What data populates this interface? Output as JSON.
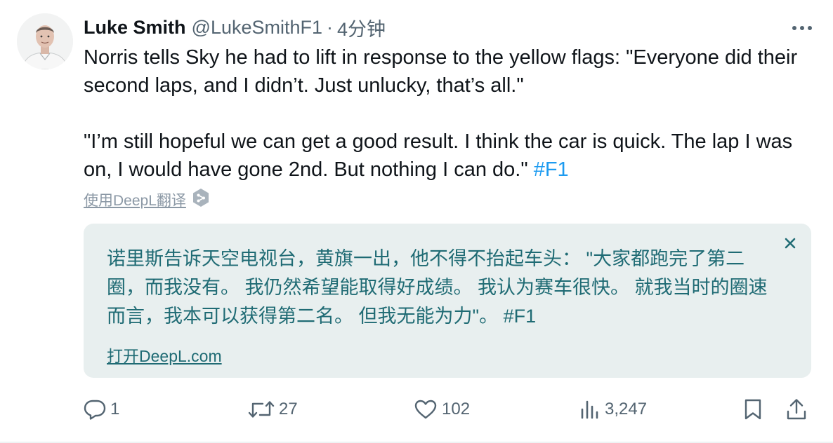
{
  "author": {
    "display_name": "Luke Smith",
    "handle": "@LukeSmithF1",
    "separator": "·",
    "time": "4分钟"
  },
  "tweet": {
    "paragraph1": "Norris tells Sky he had to lift in response to the yellow flags: \"Everyone did their second laps, and I didn’t. Just unlucky, that’s all.\"",
    "paragraph2": "\"I’m still hopeful we can get a good result. I think the car is quick. The lap I was on, I would have gone 2nd. But nothing I can do.\"",
    "hashtag": "#F1"
  },
  "translate": {
    "link_label": "使用DeepL翻译",
    "result_text": "诺里斯告诉天空电视台，黄旗一出，他不得不抬起车头：  \"大家都跑完了第二圈，而我没有。 我仍然希望能取得好成绩。 我认为赛车很快。 就我当时的圈速而言，我本可以获得第二名。 但我无能为力\"。 #F1",
    "open_label": "打开DeepL.com"
  },
  "actions": {
    "reply_count": "1",
    "retweet_count": "27",
    "like_count": "102",
    "views_count": "3,247"
  },
  "icons": {
    "more": "more-horizontal-icon",
    "deepl": "deepl-icon",
    "close": "close-icon",
    "reply": "reply-icon",
    "retweet": "retweet-icon",
    "like": "heart-icon",
    "views": "views-icon",
    "bookmark": "bookmark-icon",
    "share": "share-icon"
  },
  "colors": {
    "link_blue": "#1d9bf0",
    "secondary_text": "#536471",
    "deepl_box_bg": "#e8efef",
    "deepl_text": "#1f6b74"
  }
}
